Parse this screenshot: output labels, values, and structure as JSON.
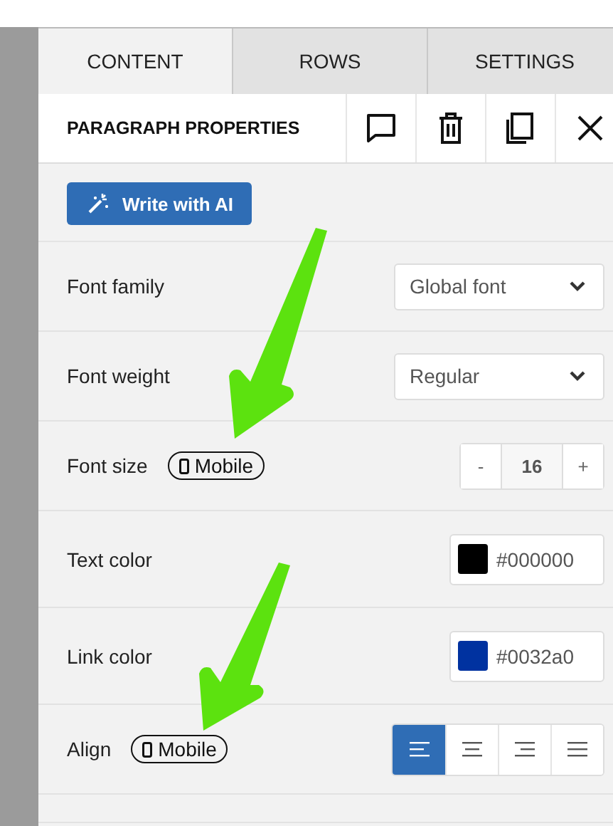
{
  "tabs": [
    {
      "label": "CONTENT",
      "selected": true
    },
    {
      "label": "ROWS",
      "selected": false
    },
    {
      "label": "SETTINGS",
      "selected": false
    }
  ],
  "header": {
    "title": "PARAGRAPH PROPERTIES"
  },
  "ai_button": "Write with AI",
  "rows": [
    {
      "kind": "select",
      "label": "Font family",
      "value": "Global font"
    },
    {
      "kind": "select",
      "label": "Font weight",
      "value": "Regular"
    },
    {
      "kind": "stepper",
      "label": "Font size",
      "badge": "Mobile",
      "minus": "-",
      "value": "16",
      "plus": "+"
    },
    {
      "kind": "color",
      "label": "Text color",
      "value": "#000000",
      "color": "#000000"
    },
    {
      "kind": "color",
      "label": "Link color",
      "value": "#0032a0",
      "color": "#0032a0"
    },
    {
      "kind": "align",
      "label": "Align",
      "badge": "Mobile",
      "options": [
        {
          "kind": "left",
          "selected": true
        },
        {
          "kind": "center",
          "selected": false
        },
        {
          "kind": "right",
          "selected": false
        },
        {
          "kind": "justify",
          "selected": false
        }
      ]
    }
  ]
}
